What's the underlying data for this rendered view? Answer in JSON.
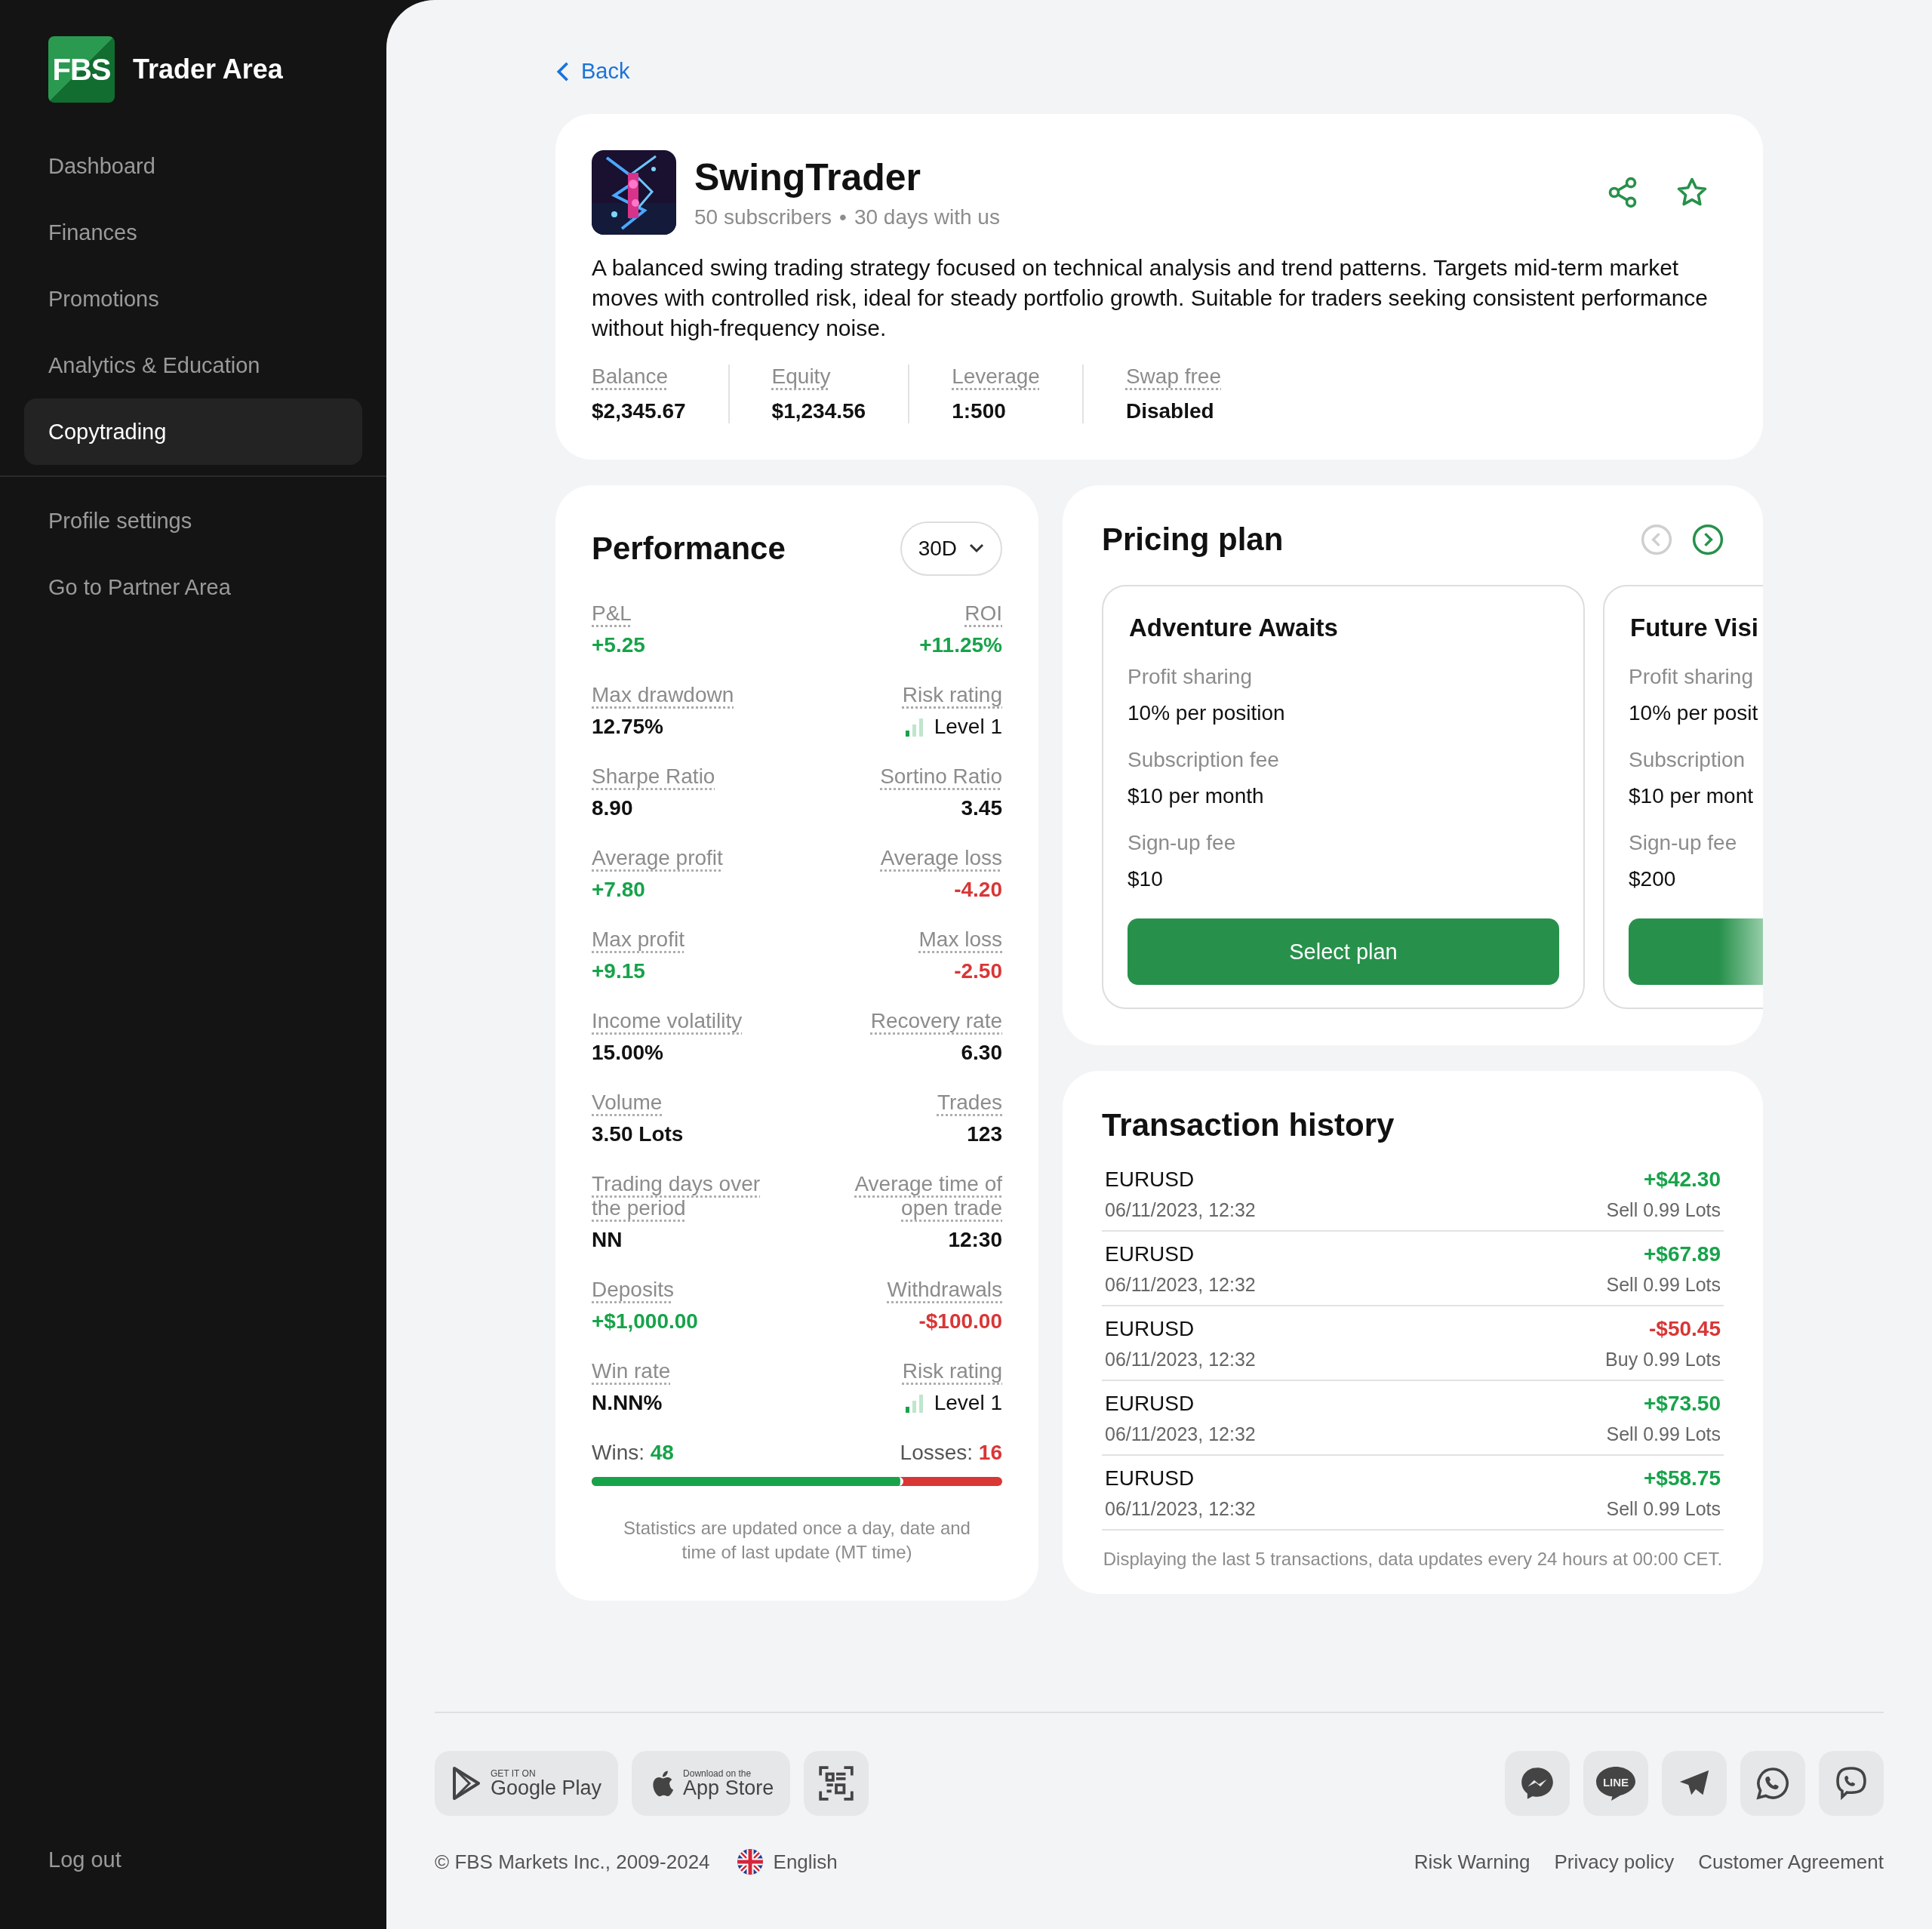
{
  "sidebar": {
    "logo_mark": "FBS",
    "title": "Trader Area",
    "nav_items": [
      {
        "label": "Dashboard",
        "selected": false
      },
      {
        "label": "Finances",
        "selected": false
      },
      {
        "label": "Promotions",
        "selected": false
      },
      {
        "label": "Analytics & Education",
        "selected": false
      },
      {
        "label": "Copytrading",
        "selected": true
      }
    ],
    "secondary_items": [
      "Profile settings",
      "Go to Partner Area"
    ],
    "logout": "Log out"
  },
  "back": "Back",
  "strategy": {
    "name": "SwingTrader",
    "subscribers": "50 subscribers",
    "separator": "•",
    "tenure": "30 days with us",
    "description": "A balanced swing trading strategy focused on technical analysis and trend patterns. Targets mid-term market moves with controlled risk, ideal for steady portfolio growth. Suitable for traders seeking consistent performance without high-frequency noise.",
    "stats": [
      {
        "label": "Balance",
        "value": "$2,345.67"
      },
      {
        "label": "Equity",
        "value": "$1,234.56"
      },
      {
        "label": "Leverage",
        "value": "1:500"
      },
      {
        "label": "Swap free",
        "value": "Disabled"
      }
    ]
  },
  "performance": {
    "title": "Performance",
    "period": "30D",
    "metrics": [
      [
        {
          "label": "P&L",
          "value": "+5.25",
          "color": "#17a34a"
        },
        {
          "label": "ROI",
          "value": "+11.25%",
          "color": "#17a34a"
        }
      ],
      [
        {
          "label": "Max drawdown",
          "value": "12.75%",
          "color": "#111111"
        },
        {
          "label": "Risk rating",
          "value": "Level 1",
          "color": "#111111",
          "kind": "risk",
          "level": 0.34
        }
      ],
      [
        {
          "label": "Sharpe Ratio",
          "value": "8.90",
          "color": "#111111"
        },
        {
          "label": "Sortino Ratio",
          "value": "3.45",
          "color": "#111111"
        }
      ],
      [
        {
          "label": "Average profit",
          "value": "+7.80",
          "color": "#17a34a"
        },
        {
          "label": "Average loss",
          "value": "-4.20",
          "color": "#d93636"
        }
      ],
      [
        {
          "label": "Max profit",
          "value": "+9.15",
          "color": "#17a34a"
        },
        {
          "label": "Max loss",
          "value": "-2.50",
          "color": "#d93636"
        }
      ],
      [
        {
          "label": "Income volatility",
          "value": "15.00%",
          "color": "#111111"
        },
        {
          "label": "Recovery rate",
          "value": "6.30",
          "color": "#111111"
        }
      ],
      [
        {
          "label": "Volume",
          "value": "3.50 Lots",
          "color": "#111111"
        },
        {
          "label": "Trades",
          "value": "123",
          "color": "#111111"
        }
      ],
      [
        {
          "label": "Trading days over the period",
          "value": "NN",
          "color": "#111111"
        },
        {
          "label": "Average time of open trade",
          "value": "12:30",
          "color": "#111111"
        }
      ],
      [
        {
          "label": "Deposits",
          "value": "+$1,000.00",
          "color": "#17a34a"
        },
        {
          "label": "Withdrawals",
          "value": "-$100.00",
          "color": "#d93636"
        }
      ],
      [
        {
          "label": "Win rate",
          "value": "N.NN%",
          "color": "#111111"
        },
        {
          "label": "Risk rating",
          "value": "Level 1",
          "color": "#111111",
          "kind": "risk",
          "level": 0.34
        }
      ]
    ],
    "wins": {
      "label": "Wins:",
      "value": "48"
    },
    "losses": {
      "label": "Losses:",
      "value": "16"
    },
    "wins_share": {
      "level": 0.76
    },
    "note": "Statistics are updated once a day, date and time of last update (MT time)"
  },
  "pricing": {
    "title": "Pricing plan",
    "prev_disabled": true,
    "next_disabled": false,
    "plans": [
      {
        "name": "Adventure Awaits",
        "rows": [
          {
            "label": "Profit sharing",
            "value": "10% per position"
          },
          {
            "label": "Subscription fee",
            "value": "$10 per month"
          },
          {
            "label": "Sign-up fee",
            "value": "$10"
          }
        ],
        "button": "Select plan"
      },
      {
        "name": "Future Visi",
        "rows": [
          {
            "label": "Profit sharing",
            "value": "10% per posit"
          },
          {
            "label": "Subscription",
            "value": "$10 per mont"
          },
          {
            "label": "Sign-up fee",
            "value": "$200"
          }
        ]
      }
    ]
  },
  "transactions": {
    "title": "Transaction history",
    "rows": [
      {
        "symbol": "EURUSD",
        "date": "06/11/2023, 12:32",
        "amount": "+$42.30",
        "color": "#17a34a",
        "detail": "Sell 0.99 Lots"
      },
      {
        "symbol": "EURUSD",
        "date": "06/11/2023, 12:32",
        "amount": "+$67.89",
        "color": "#17a34a",
        "detail": "Sell 0.99 Lots"
      },
      {
        "symbol": "EURUSD",
        "date": "06/11/2023, 12:32",
        "amount": "-$50.45",
        "color": "#d93636",
        "detail": "Buy 0.99 Lots"
      },
      {
        "symbol": "EURUSD",
        "date": "06/11/2023, 12:32",
        "amount": "+$73.50",
        "color": "#17a34a",
        "detail": "Sell 0.99 Lots"
      },
      {
        "symbol": "EURUSD",
        "date": "06/11/2023, 12:32",
        "amount": "+$58.75",
        "color": "#17a34a",
        "detail": "Sell 0.99 Lots"
      }
    ],
    "note": "Displaying the last 5 transactions, data updates every 24 hours at 00:00 CET."
  },
  "footer": {
    "stores": [
      {
        "kind": "google",
        "small": "GET IT ON",
        "big": "Google Play"
      },
      {
        "kind": "apple",
        "small": "Download on the",
        "big": "App Store"
      }
    ],
    "social": [
      {
        "kind": "messenger"
      },
      {
        "kind": "line",
        "text": "LINE"
      },
      {
        "kind": "telegram"
      },
      {
        "kind": "whatsapp"
      },
      {
        "kind": "viber"
      }
    ],
    "copyright": "© FBS Markets Inc., 2009-2024",
    "language": "English",
    "links": [
      "Risk Warning",
      "Privacy policy",
      "Customer Agreement"
    ]
  }
}
